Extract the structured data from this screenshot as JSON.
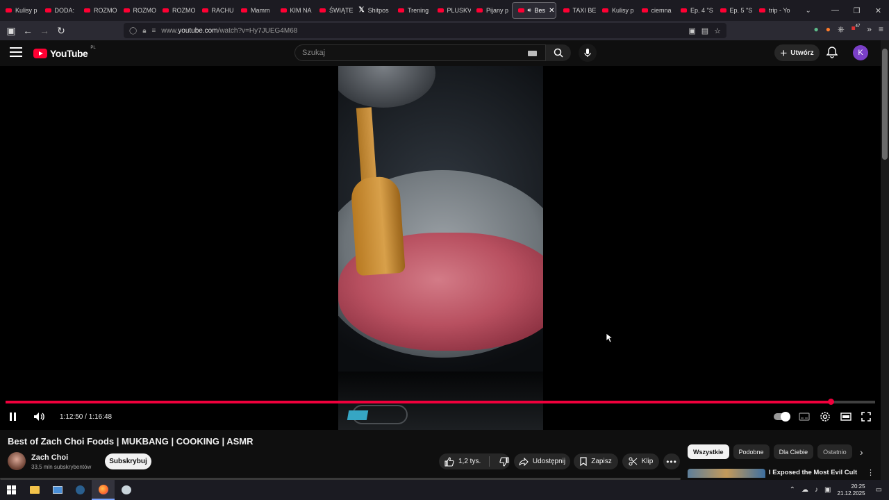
{
  "browser": {
    "tabs": [
      {
        "label": "Kulisy p",
        "icon": "youtube-icon"
      },
      {
        "label": "DODA:",
        "icon": "youtube-icon"
      },
      {
        "label": "ROZMO",
        "icon": "youtube-icon"
      },
      {
        "label": "ROZMO",
        "icon": "youtube-icon"
      },
      {
        "label": "ROZMO",
        "icon": "youtube-icon"
      },
      {
        "label": "RACHU",
        "icon": "youtube-icon"
      },
      {
        "label": "Mamm",
        "icon": "youtube-icon"
      },
      {
        "label": "KIM NA",
        "icon": "youtube-icon"
      },
      {
        "label": "ŚWIĄTE",
        "icon": "youtube-icon"
      },
      {
        "label": "Shitpos",
        "icon": "x-icon"
      },
      {
        "label": "Trening",
        "icon": "youtube-icon"
      },
      {
        "label": "PLUSKV",
        "icon": "youtube-icon"
      },
      {
        "label": "Pijany p",
        "icon": "youtube-icon"
      },
      {
        "label": "Bes",
        "icon": "youtube-icon",
        "active": true
      },
      {
        "label": "TAXI BE",
        "icon": "youtube-icon"
      },
      {
        "label": "Kulisy p",
        "icon": "youtube-icon"
      },
      {
        "label": "ciemna",
        "icon": "youtube-icon"
      },
      {
        "label": "Ep. 4 \"S",
        "icon": "youtube-icon"
      },
      {
        "label": "Ep. 5 \"S",
        "icon": "youtube-icon"
      },
      {
        "label": "trip - Yo",
        "icon": "youtube-icon"
      }
    ],
    "url_prefix": "www.",
    "url_host": "youtube.com",
    "url_path": "/watch?v=Hy7JUEG4M68",
    "ext_badge": "47"
  },
  "youtube": {
    "logo_text": "YouTube",
    "country_code": "PL",
    "search_placeholder": "Szukaj",
    "create_label": "Utwórz",
    "avatar_letter": "K"
  },
  "player": {
    "current_time": "1:12:50",
    "duration": "1:16:48",
    "time_display": "1:12:50 / 1:16:48",
    "progress_fraction": 0.9485
  },
  "video": {
    "title": "Best of Zach Choi Foods | MUKBANG | COOKING | ASMR",
    "channel": "Zach Choi",
    "subscribers": "33,5 mln subskrybentów",
    "subscribe_label": "Subskrybuj",
    "likes": "1,2 tys.",
    "share_label": "Udostępnij",
    "save_label": "Zapisz",
    "clip_label": "Klip"
  },
  "recommendations": {
    "chips": [
      "Wszystkie",
      "Podobne",
      "Dla Ciebie",
      "Ostatnio"
    ],
    "first_title": "I Exposed the Most Evil Cult in America"
  },
  "taskbar": {
    "time": "20:25",
    "date": "21.12.2025"
  },
  "colors": {
    "accent": "#f0003c",
    "youtube_red": "#ff0033",
    "background": "#0f0f0f"
  }
}
